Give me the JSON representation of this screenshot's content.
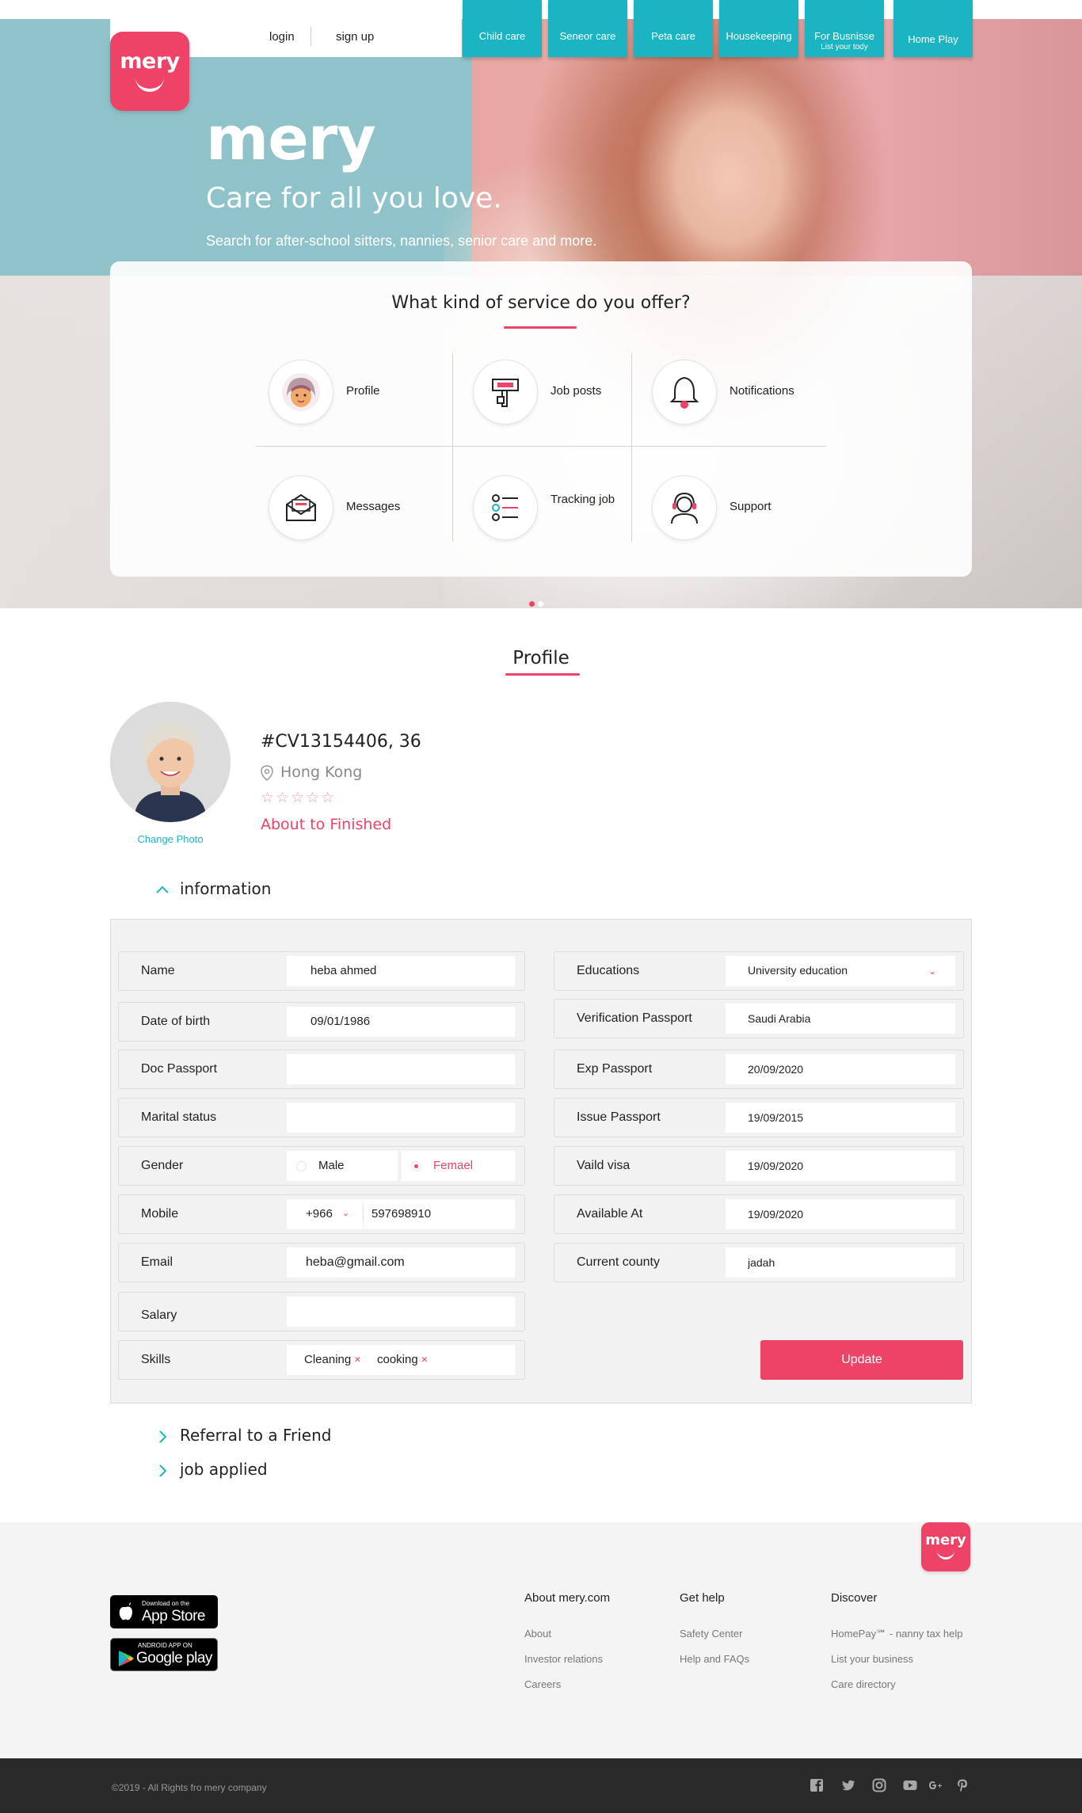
{
  "nav": {
    "login": "login",
    "signup": "sign up",
    "tabs": [
      {
        "label": "Child care",
        "sub": ""
      },
      {
        "label": "Seneor care",
        "sub": ""
      },
      {
        "label": "Peta care",
        "sub": ""
      },
      {
        "label": "Housekeeping",
        "sub": ""
      },
      {
        "label": "For Busnisse",
        "sub": "List your tody"
      },
      {
        "label": "Home Play",
        "sub": ""
      }
    ]
  },
  "brand": {
    "logo_text": "mery",
    "name": "mery",
    "tagline": "Care for all you love.",
    "subtitle": "Search for after-school sitters, nannies, senior care and more."
  },
  "services": {
    "title": "What kind of service do you offer?",
    "items": [
      {
        "label": "Profile",
        "icon": "profile-icon"
      },
      {
        "label": "Job posts",
        "icon": "job-posts-icon"
      },
      {
        "label": "Notifications",
        "icon": "bell-icon"
      },
      {
        "label": "Messages",
        "icon": "envelope-icon"
      },
      {
        "label": "Tracking job",
        "icon": "checklist-icon"
      },
      {
        "label": "Support",
        "icon": "headset-icon"
      }
    ]
  },
  "profile": {
    "section_title": "Profile",
    "change_photo": "Change Photo",
    "cv_id": "#CV13154406, 36",
    "location": "Hong Kong",
    "stars": "☆☆☆☆☆",
    "rating": 0,
    "status": "About to Finished"
  },
  "accordion": {
    "information": "information",
    "referral": "Referral to a Friend",
    "job_applied": "job applied"
  },
  "form": {
    "left": {
      "name": {
        "label": "Name",
        "value": "heba ahmed"
      },
      "dob": {
        "label": "Date of birth",
        "value": "09/01/1986"
      },
      "doc_passport": {
        "label": "Doc Passport",
        "value": ""
      },
      "marital": {
        "label": "Marital status",
        "value": ""
      },
      "gender": {
        "label": "Gender",
        "male": "Male",
        "female": "Femael",
        "selected": "female"
      },
      "mobile": {
        "label": "Mobile",
        "code": "+966",
        "value": "597698910"
      },
      "email": {
        "label": "Email",
        "value": "heba@gmail.com"
      },
      "salary": {
        "label": "Salary",
        "value": ""
      },
      "skills": {
        "label": "Skills",
        "items": [
          "Cleaning",
          "cooking"
        ],
        "remove": "×"
      }
    },
    "right": {
      "educations": {
        "label": "Educations",
        "value": "University education"
      },
      "verification": {
        "label": "Verification Passport",
        "value": "Saudi Arabia"
      },
      "exp_passport": {
        "label": "Exp Passport",
        "value": "20/09/2020"
      },
      "issue_passport": {
        "label": "Issue Passport",
        "value": "19/09/2015"
      },
      "valid_visa": {
        "label": "Vaild visa",
        "value": "19/09/2020"
      },
      "available": {
        "label": "Available  At",
        "value": "19/09/2020"
      },
      "county": {
        "label": "Current county",
        "value": "jadah"
      }
    },
    "update_label": "Update"
  },
  "footer": {
    "logo_text": "mery",
    "app_store": {
      "small": "Download on the",
      "big": "App Store"
    },
    "google_play": {
      "small": "ANDROID APP ON",
      "big": "Google play"
    },
    "columns": [
      {
        "title": "About mery.com",
        "links": [
          "About",
          "Investor relations",
          "Careers"
        ]
      },
      {
        "title": "Get help",
        "links": [
          "Safety Center",
          "Help and FAQs"
        ]
      },
      {
        "title": "Discover",
        "links": [
          "HomePay℠ - nanny tax help",
          "List your business",
          "Care directory"
        ]
      }
    ],
    "copyright": "©2019 - All Rights fro mery company",
    "social": [
      "facebook-icon",
      "twitter-icon",
      "instagram-icon",
      "youtube-icon",
      "google-plus-icon",
      "pinterest-icon"
    ]
  },
  "colors": {
    "accent": "#ee4266",
    "teal": "#1bb4c3"
  }
}
